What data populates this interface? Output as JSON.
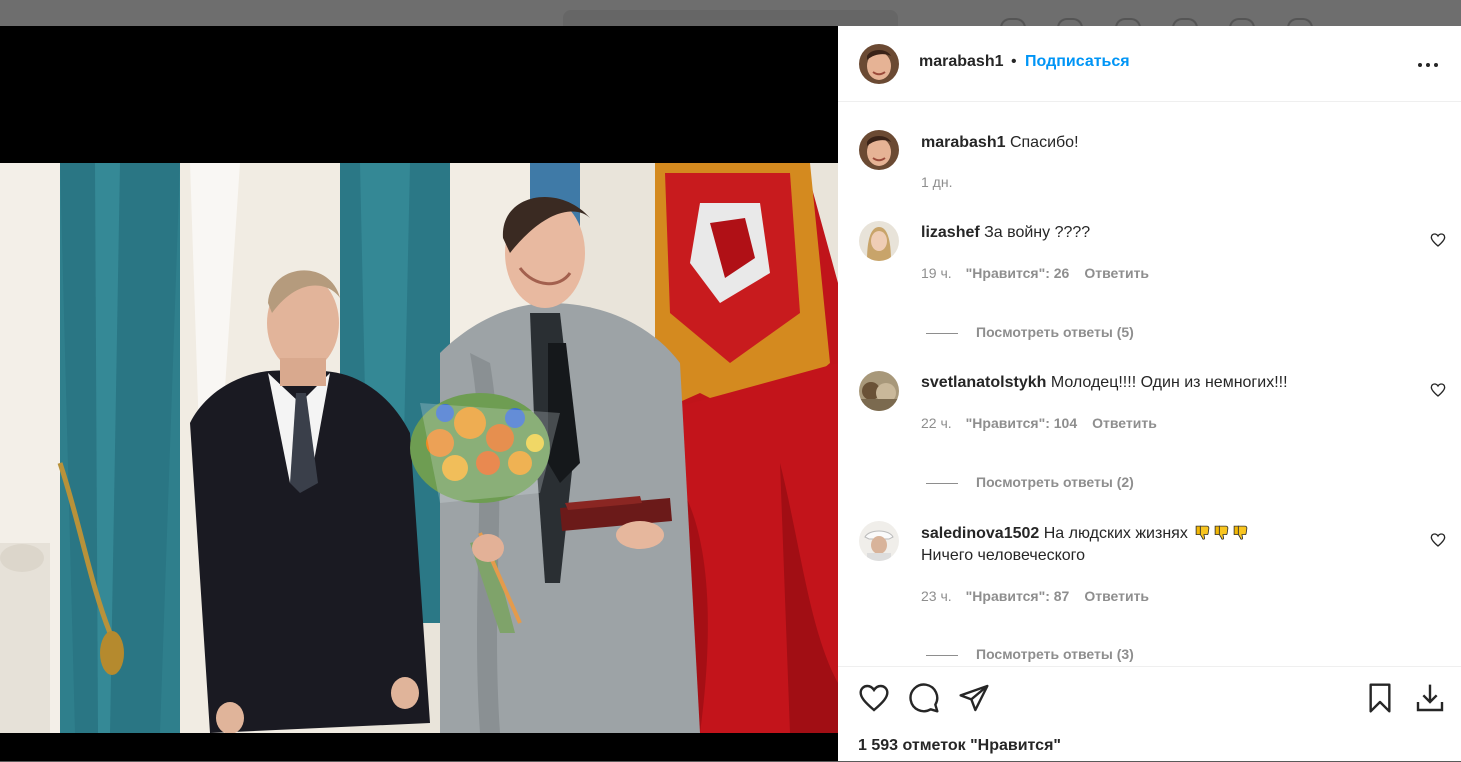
{
  "post": {
    "author": "marabash1",
    "follow_label": "Подписаться",
    "separator": "•",
    "caption_text": "Спасибо!",
    "caption_time": "1 дн."
  },
  "comments": [
    {
      "username": "lizashef",
      "text": "За войну ????",
      "time": "19 ч.",
      "likes": "\"Нравится\": 26",
      "reply": "Ответить",
      "view_replies": "Посмотреть ответы (5)"
    },
    {
      "username": "svetlanatolstykh",
      "text": "Молодец!!!! Один из немногих!!!",
      "time": "22 ч.",
      "likes": "\"Нравится\": 104",
      "reply": "Ответить",
      "view_replies": "Посмотреть ответы (2)"
    },
    {
      "username": "saledinova1502",
      "text": "На людских жизнях",
      "text_line2": "Ничего человеческого",
      "emoji": "thumbs-down-icon ×3",
      "time": "23 ч.",
      "likes": "\"Нравится\": 87",
      "reply": "Ответить",
      "view_replies": "Посмотреть ответы (3)"
    }
  ],
  "footer": {
    "likes_total": "1 593 отметок \"Нравится\""
  },
  "icons": {
    "like": "heart-icon",
    "comment": "comment-icon",
    "share": "share-icon",
    "save": "bookmark-icon",
    "download": "download-icon",
    "more": "more-options-icon"
  },
  "colors": {
    "link_blue": "#0095f6",
    "text": "#262626",
    "muted": "#8e8e8e"
  }
}
